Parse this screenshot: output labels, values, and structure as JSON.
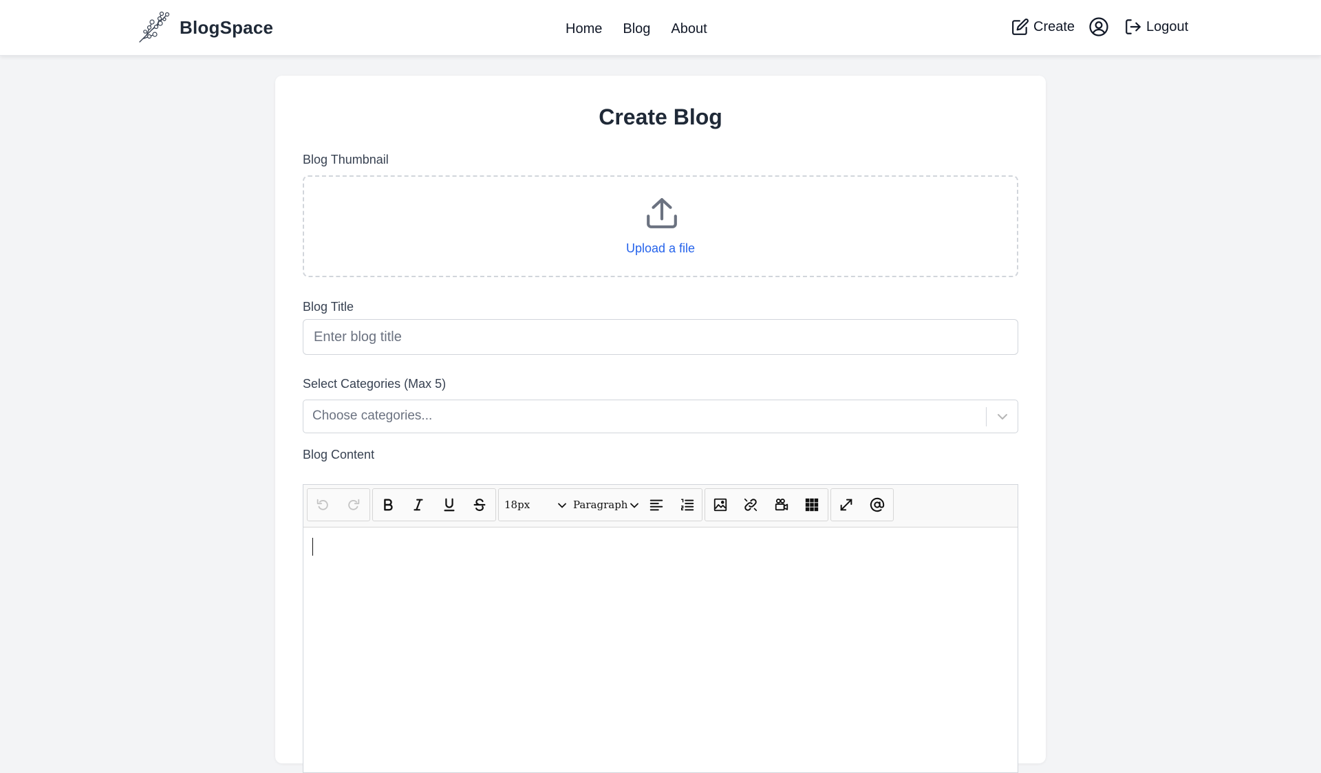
{
  "header": {
    "brand_name": "BlogSpace",
    "logo_icon": "cherry-blossom-branch-icon",
    "nav": [
      {
        "label": "Home"
      },
      {
        "label": "Blog"
      },
      {
        "label": "About"
      }
    ],
    "actions": {
      "create_label": "Create",
      "create_icon": "edit-square-icon",
      "profile_icon": "user-circle-icon",
      "logout_label": "Logout",
      "logout_icon": "logout-arrow-icon"
    }
  },
  "form": {
    "title": "Create Blog",
    "thumbnail": {
      "label": "Blog Thumbnail",
      "upload_link": "Upload a file",
      "icon": "upload-icon"
    },
    "blog_title": {
      "label": "Blog Title",
      "placeholder": "Enter blog title",
      "value": ""
    },
    "categories": {
      "label": "Select Categories (Max 5)",
      "placeholder": "Choose categories..."
    },
    "content": {
      "label": "Blog Content",
      "toolbar": {
        "font_size": "18px",
        "block_format": "Paragraph",
        "buttons": [
          "undo",
          "redo",
          "bold",
          "italic",
          "underline",
          "strikethrough",
          "font-size",
          "paragraph-format",
          "align-left",
          "ordered-list",
          "image",
          "link",
          "video",
          "table",
          "fullscreen",
          "mention"
        ]
      }
    }
  },
  "colors": {
    "background": "#f3f4f6",
    "card": "#ffffff",
    "link": "#2563eb",
    "text_dark": "#1f2937",
    "border": "#d1d5db",
    "toolbar_bg": "#f9f9f9"
  }
}
